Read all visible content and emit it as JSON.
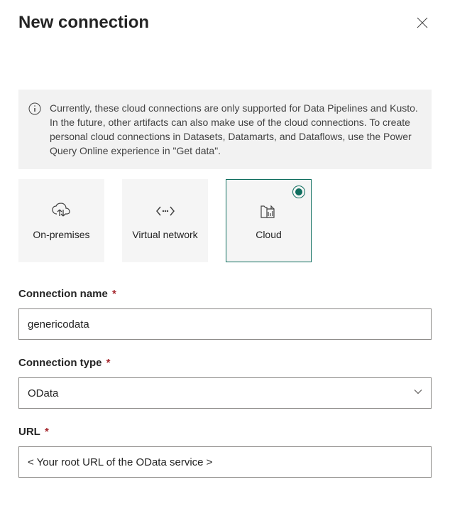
{
  "header": {
    "title": "New connection"
  },
  "info": {
    "text": "Currently, these cloud connections are only supported for Data Pipelines and Kusto. In the future, other artifacts can also make use of the cloud connections. To create personal cloud connections in Datasets, Datamarts, and Dataflows, use the Power Query Online experience in \"Get data\"."
  },
  "connectionTypes": {
    "onprem": {
      "label": "On-premises"
    },
    "vnet": {
      "label": "Virtual network"
    },
    "cloud": {
      "label": "Cloud",
      "selected": true
    }
  },
  "form": {
    "connectionName": {
      "label": "Connection name",
      "value": "genericodata"
    },
    "connectionType": {
      "label": "Connection type",
      "value": "OData"
    },
    "url": {
      "label": "URL",
      "value": "< Your root URL of the OData service >"
    }
  }
}
